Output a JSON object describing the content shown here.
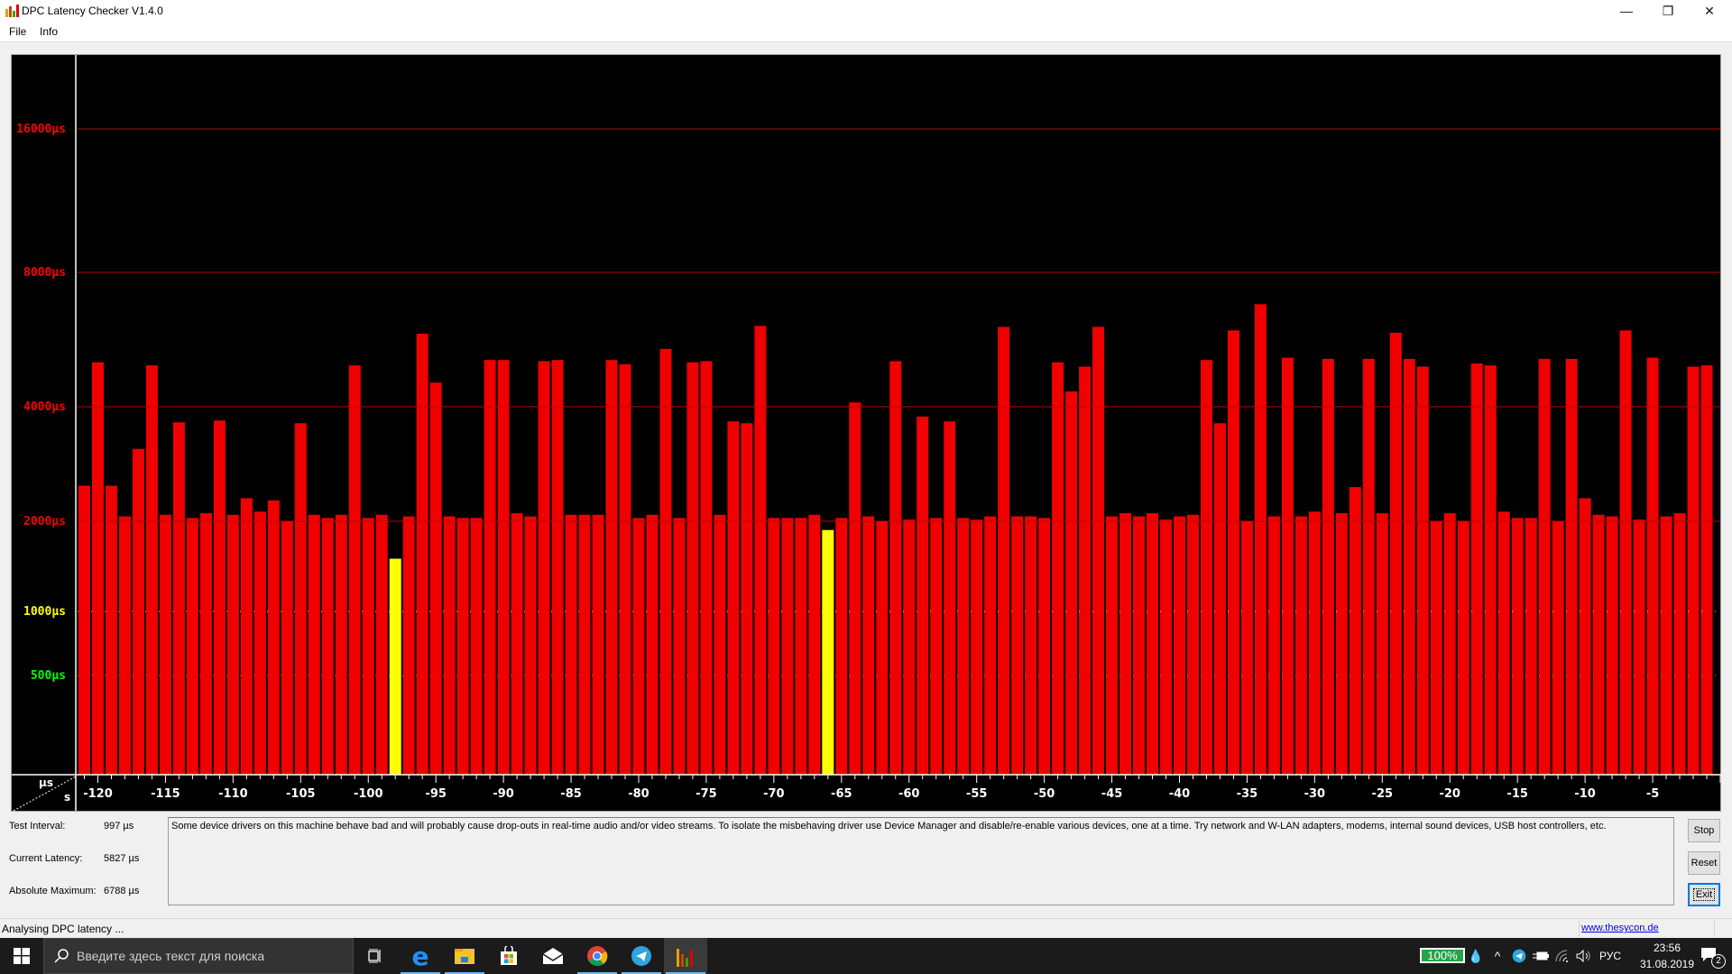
{
  "window": {
    "title": "DPC Latency Checker V1.4.0",
    "controls": {
      "minimize": "—",
      "restore": "❐",
      "close": "✕"
    }
  },
  "menu": [
    "File",
    "Info"
  ],
  "colors": {
    "bar_red": "#f00000",
    "bar_yellow": "#ffff00",
    "bar_green": "#00e000",
    "grid_red": "#c00000",
    "grid_yellow": "#ffff00",
    "grid_green": "#00ff00",
    "label_red": "#ff0000",
    "label_yellow": "#ffff00",
    "label_green": "#00ff00",
    "chart_bg": "#000000",
    "axis_white": "#ffffff"
  },
  "chart_data": {
    "type": "bar",
    "title": "",
    "xlabel": "s",
    "ylabel": "µs",
    "y_scale": "non-linear (log-like)",
    "y_gridlines": [
      {
        "value": 16000,
        "label": "16000µs",
        "color": "red"
      },
      {
        "value": 8000,
        "label": "8000µs",
        "color": "red"
      },
      {
        "value": 4000,
        "label": "4000µs",
        "color": "red"
      },
      {
        "value": 2000,
        "label": "2000µs",
        "color": "red"
      },
      {
        "value": 1000,
        "label": "1000µs",
        "color": "yellow"
      },
      {
        "value": 500,
        "label": "500µs",
        "color": "green"
      }
    ],
    "x_ticks": [
      -120,
      -115,
      -110,
      -105,
      -100,
      -95,
      -90,
      -85,
      -80,
      -75,
      -70,
      -65,
      -60,
      -55,
      -50,
      -45,
      -40,
      -35,
      -30,
      -25,
      -20,
      -15,
      -10,
      -5
    ],
    "x_range": [
      -121.5,
      0
    ],
    "ylim": [
      0,
      20000
    ],
    "threshold_yellow": 1000,
    "threshold_red": 2000,
    "values": [
      2480,
      5030,
      2480,
      2060,
      3100,
      4950,
      2080,
      3640,
      2040,
      2100,
      3680,
      2080,
      2300,
      2120,
      2270,
      2000,
      3620,
      2080,
      2040,
      2080,
      4950,
      2040,
      2080,
      1500,
      2060,
      5830,
      4530,
      2060,
      2040,
      2040,
      5090,
      5090,
      2100,
      2060,
      5060,
      5090,
      2080,
      2080,
      2080,
      5090,
      4980,
      2040,
      2080,
      5390,
      2040,
      5030,
      5060,
      2080,
      3660,
      3620,
      6070,
      2040,
      2040,
      2040,
      2080,
      1870,
      2040,
      4090,
      2060,
      2000,
      5060,
      2020,
      3770,
      2040,
      3660,
      2040,
      2020,
      2060,
      6040,
      2060,
      2060,
      2040,
      5030,
      4330,
      4920,
      6040,
      2060,
      2100,
      2060,
      2100,
      2020,
      2060,
      2080,
      5090,
      3620,
      5930,
      2000,
      6788,
      2060,
      5150,
      2060,
      2120,
      5120,
      2100,
      2460,
      5120,
      2100,
      5860,
      5120,
      4920,
      2000,
      2100,
      2000,
      5000,
      4950,
      2120,
      2040,
      2040,
      5120,
      2000,
      5120,
      2300,
      2080,
      2060,
      5930,
      2020,
      5150,
      2060,
      2100,
      4920,
      4950
    ]
  },
  "axis_corner": {
    "y_unit": "µs",
    "x_unit": "s"
  },
  "stats": {
    "test_interval_label": "Test Interval:",
    "test_interval_value": "997 µs",
    "current_latency_label": "Current Latency:",
    "current_latency_value": "5827 µs",
    "absolute_maximum_label": "Absolute Maximum:",
    "absolute_maximum_value": "6788 µs"
  },
  "message": "Some device drivers on this machine behave bad and will probably cause drop-outs in real-time audio and/or video streams. To isolate the misbehaving driver use Device Manager and disable/re-enable various devices, one at a time. Try network and W-LAN adapters, modems, internal sound devices, USB host controllers, etc.",
  "buttons": {
    "stop": "Stop",
    "reset": "Reset",
    "exit": "Exit"
  },
  "status": {
    "text": "Analysing DPC latency ...",
    "link": "www.thesycon.de"
  },
  "taskbar": {
    "search_placeholder": "Введите здесь текст для поиска",
    "apps": [
      "task-view",
      "edge",
      "file-explorer",
      "store",
      "mail",
      "chrome",
      "telegram",
      "dpc-latency-checker"
    ],
    "battery_percent": "100%",
    "language": "РУС",
    "time": "23:56",
    "date": "31.08.2019",
    "notifications_count": "2"
  }
}
